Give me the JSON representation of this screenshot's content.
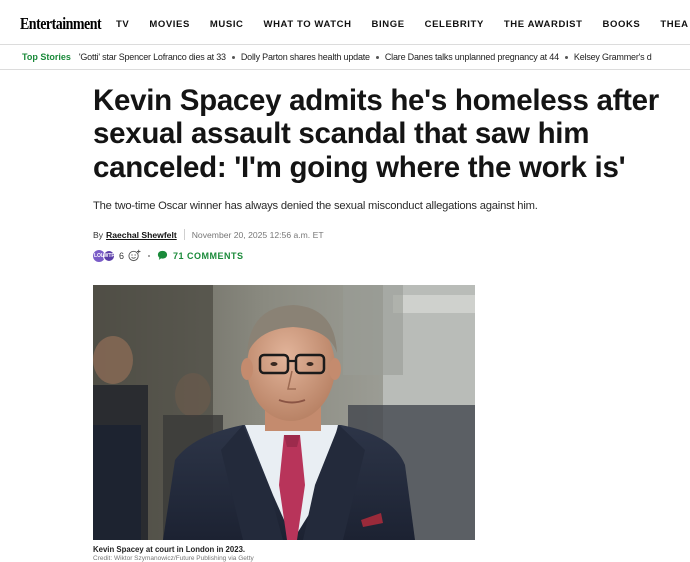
{
  "header": {
    "logo": "Entertainment",
    "nav": [
      "TV",
      "MOVIES",
      "MUSIC",
      "WHAT TO WATCH",
      "BINGE",
      "CELEBRITY",
      "THE AWARDIST",
      "BOOKS",
      "THEA"
    ]
  },
  "ticker": {
    "label": "Top Stories",
    "items": [
      "'Gotti' star Spencer Lofranco dies at 33",
      "Dolly Parton shares health update",
      "Clare Danes talks unplanned pregnancy at 44",
      "Kelsey Grammer's d"
    ]
  },
  "article": {
    "headline": "Kevin Spacey admits he's homeless after sexual assault scandal that saw him canceled: 'I'm going where the work is'",
    "subhead": "The two-time Oscar winner has always denied the sexual misconduct allegations against him.",
    "by": "By",
    "author": "Raechal Shewfelt",
    "date": "November 20, 2025 12:56 a.m. ET",
    "reaction_badges": [
      "LOL",
      "WTF"
    ],
    "reaction_count": "6",
    "comments_label": "71 COMMENTS",
    "caption": "Kevin Spacey at court in London in 2023.",
    "credit": "Credit: Wiktor Szymanowicz/Future Publishing via Getty"
  },
  "colors": {
    "accent_green": "#1a8a3a",
    "reaction_purple": "#7a5cc8"
  }
}
